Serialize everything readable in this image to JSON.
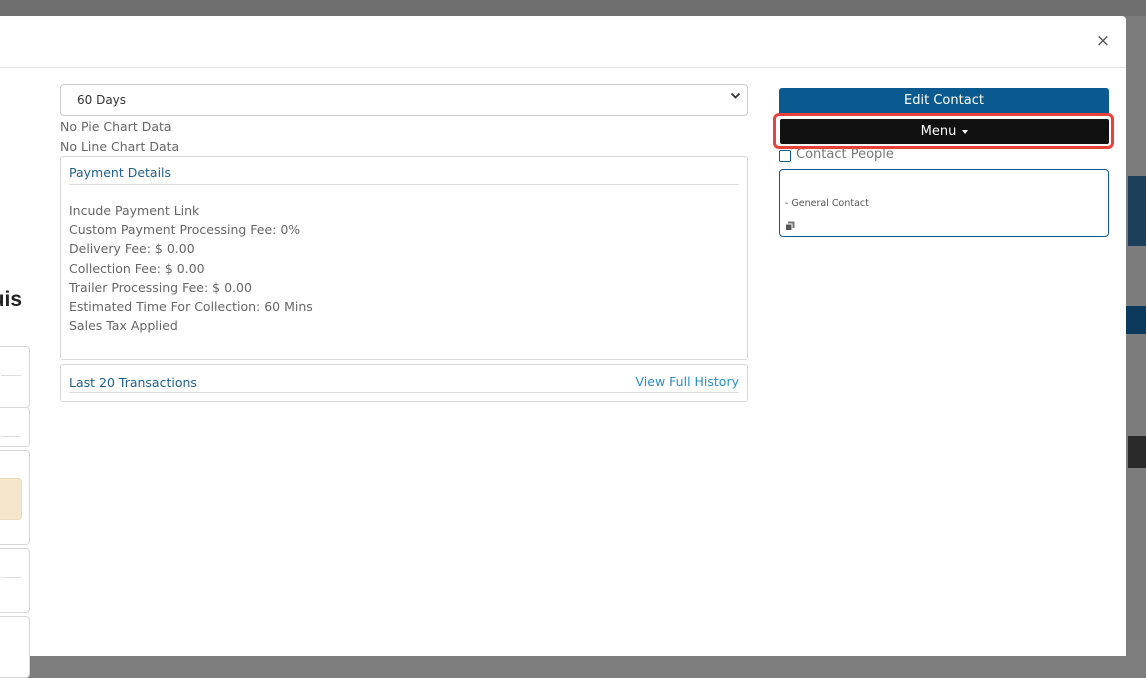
{
  "modal": {
    "close_glyph": "×"
  },
  "left_column": {
    "partial_heading": "uis"
  },
  "filter": {
    "period_value": "60 Days"
  },
  "charts": {
    "pie_empty": "No Pie Chart Data",
    "line_empty": "No Line Chart Data"
  },
  "payment_details": {
    "title": "Payment Details",
    "lines": [
      "Incude Payment Link",
      "Custom Payment Processing Fee: 0%",
      "Delivery Fee: $ 0.00",
      "Collection Fee: $ 0.00",
      "Trailer Processing Fee: $ 0.00",
      "Estimated Time For Collection: 60 Mins",
      "Sales Tax Applied"
    ]
  },
  "transactions": {
    "title": "Last 20 Transactions",
    "view_link": "View Full History"
  },
  "actions": {
    "edit_contact": "Edit Contact",
    "menu": "Menu"
  },
  "contact_people": {
    "label": "Contact People",
    "entry_type": "- General Contact"
  },
  "colors": {
    "primary": "#0a5a8f",
    "menu_bg": "#111111",
    "highlight": "#e8433a",
    "link": "#2a8fc6"
  }
}
